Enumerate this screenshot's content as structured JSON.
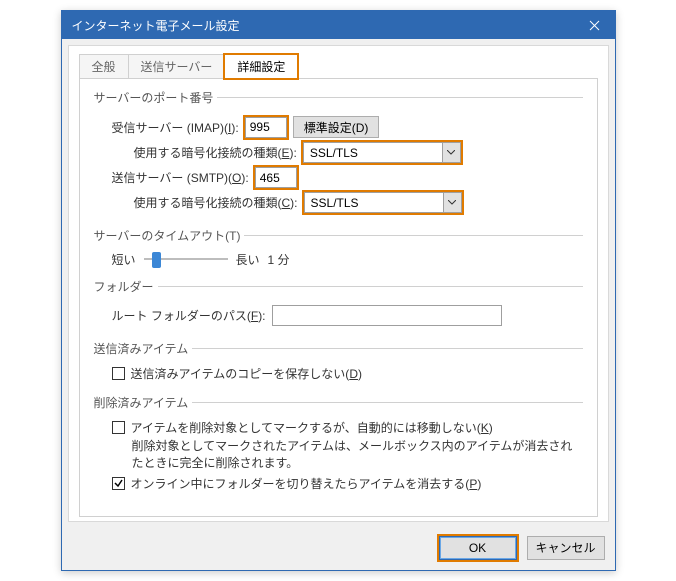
{
  "window": {
    "title": "インターネット電子メール設定"
  },
  "tabs": {
    "general": "全般",
    "outgoing": "送信サーバー",
    "advanced": "詳細設定"
  },
  "groups": {
    "ports": "サーバーのポート番号",
    "timeout": "サーバーのタイムアウト(T)",
    "folder": "フォルダー",
    "sent": "送信済みアイテム",
    "deleted": "削除済みアイテム"
  },
  "ports": {
    "imap_label_pre": "受信サーバー (IMAP)(",
    "imap_key": "I",
    "imap_label_post": "):",
    "imap_value": "995",
    "default_btn_pre": "標準設定(",
    "default_btn_key": "D",
    "default_btn_post": ")",
    "enc_in_label_pre": "使用する暗号化接続の種類(",
    "enc_in_key": "E",
    "enc_in_label_post": "):",
    "enc_in_value": "SSL/TLS",
    "smtp_label_pre": "送信サーバー (SMTP)(",
    "smtp_key": "O",
    "smtp_label_post": "):",
    "smtp_value": "465",
    "enc_out_label_pre": "使用する暗号化接続の種類(",
    "enc_out_key": "C",
    "enc_out_label_post": "):",
    "enc_out_value": "SSL/TLS"
  },
  "timeout": {
    "short": "短い",
    "long": "長い",
    "value": "1 分"
  },
  "folder": {
    "root_label_pre": "ルート フォルダーのパス(",
    "root_key": "F",
    "root_label_post": "):",
    "root_value": ""
  },
  "sent": {
    "cb_label_pre": "送信済みアイテムのコピーを保存しない(",
    "cb_key": "D",
    "cb_label_post": ")",
    "cb_checked": false
  },
  "deleted": {
    "cb1_label_pre": "アイテムを削除対象としてマークするが、自動的には移動しない(",
    "cb1_key": "K",
    "cb1_label_post": ")",
    "cb1_checked": false,
    "note": "削除対象としてマークされたアイテムは、メールボックス内のアイテムが消去されたときに完全に削除されます。",
    "cb2_label_pre": "オンライン中にフォルダーを切り替えたらアイテムを消去する(",
    "cb2_key": "P",
    "cb2_label_post": ")",
    "cb2_checked": true
  },
  "footer": {
    "ok": "OK",
    "cancel": "キャンセル"
  }
}
